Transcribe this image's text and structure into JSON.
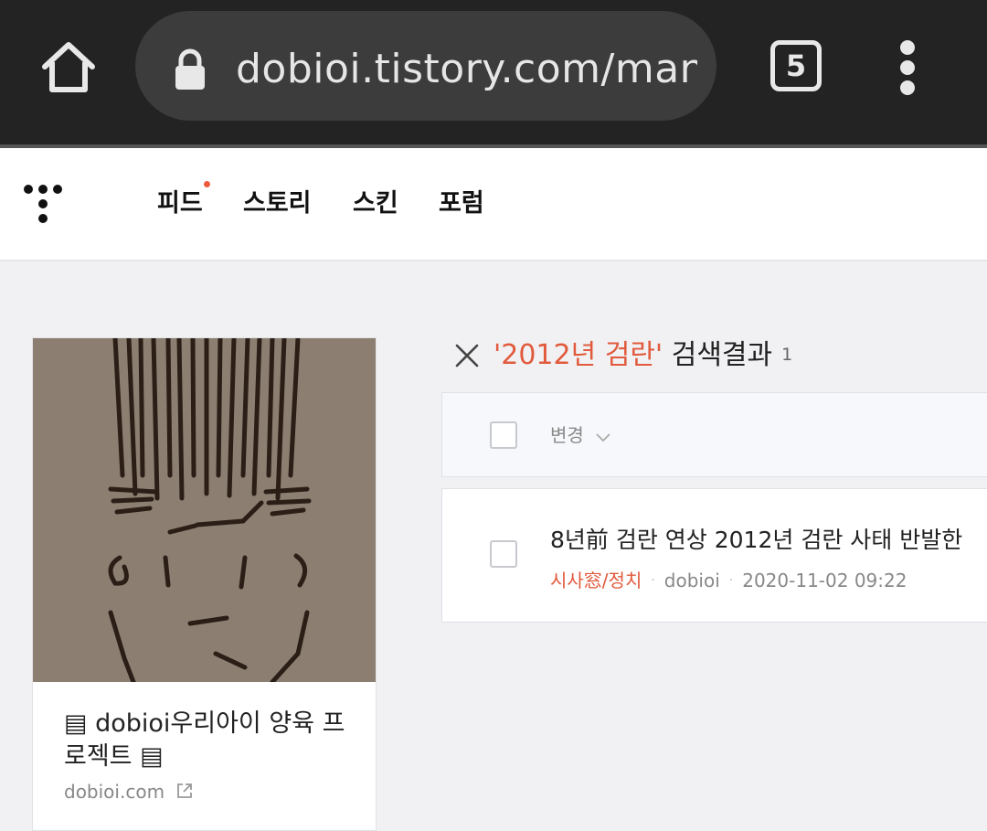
{
  "browser": {
    "url": "dobioi.tistory.com/manage/posts",
    "tab_count": "5",
    "icons": {
      "home": "home-icon",
      "lock": "lock-icon",
      "menu": "more-vertical-icon"
    }
  },
  "header": {
    "logo": "tistory-logo",
    "nav": [
      {
        "label": "피드",
        "has_new": true
      },
      {
        "label": "스토리"
      },
      {
        "label": "스킨"
      },
      {
        "label": "포럼"
      }
    ],
    "accent": "#ee5a3a"
  },
  "blog_card": {
    "title": "▤ dobioi우리아이 양육 프로젝트 ▤",
    "domain": "dobioi.com"
  },
  "search": {
    "term": "'2012년 검란'",
    "suffix": " 검색결과",
    "count": "1"
  },
  "list": {
    "change_label": "변경",
    "posts": [
      {
        "title": "8년前 검란 연상 2012년 검란 사태 반발한",
        "category": "시사窓/정치",
        "author": "dobioi",
        "datetime": "2020-11-02 09:22"
      }
    ]
  },
  "colors": {
    "browser_bar": "#232323",
    "url_pill": "#3c3c3c",
    "highlight": "#e15a3c",
    "background": "#f1f1f4"
  }
}
